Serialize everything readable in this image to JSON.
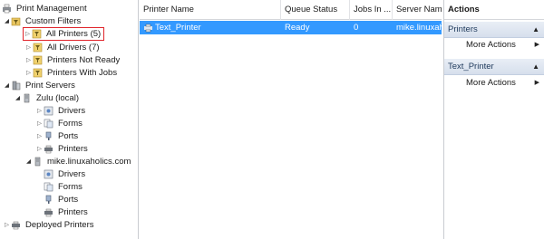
{
  "tree": {
    "items": [
      {
        "label": "Print Management",
        "icon": "print-management-icon"
      },
      {
        "label": "Custom Filters",
        "icon": "filter-folder-icon"
      },
      {
        "label": "All Printers (5)",
        "icon": "filter-icon"
      },
      {
        "label": "All Drivers (7)",
        "icon": "filter-icon"
      },
      {
        "label": "Printers Not Ready",
        "icon": "filter-icon"
      },
      {
        "label": "Printers With Jobs",
        "icon": "filter-icon"
      },
      {
        "label": "Print Servers",
        "icon": "print-servers-icon"
      },
      {
        "label": "Zulu (local)",
        "icon": "server-icon"
      },
      {
        "label": "Drivers",
        "icon": "drivers-icon"
      },
      {
        "label": "Forms",
        "icon": "forms-icon"
      },
      {
        "label": "Ports",
        "icon": "ports-icon"
      },
      {
        "label": "Printers",
        "icon": "printer-icon"
      },
      {
        "label": "mike.linuxaholics.com",
        "icon": "server-icon"
      },
      {
        "label": "Drivers",
        "icon": "drivers-icon"
      },
      {
        "label": "Forms",
        "icon": "forms-icon"
      },
      {
        "label": "Ports",
        "icon": "ports-icon"
      },
      {
        "label": "Printers",
        "icon": "printer-icon"
      },
      {
        "label": "Deployed Printers",
        "icon": "printer-icon"
      }
    ]
  },
  "list": {
    "columns": [
      "Printer Name",
      "Queue Status",
      "Jobs In ...",
      "Server Nam"
    ],
    "rows": [
      {
        "name": "Text_Printer",
        "status": "Ready",
        "jobs": "0",
        "server": "mike.linuxaholics.com"
      }
    ]
  },
  "actions": {
    "title": "Actions",
    "sections": [
      {
        "label": "Printers",
        "item": "More Actions"
      },
      {
        "label": "Text_Printer",
        "item": "More Actions"
      }
    ]
  },
  "colors": {
    "selection": "#3399ff",
    "highlight_box": "#e0242a",
    "section_text": "#1e395b"
  }
}
